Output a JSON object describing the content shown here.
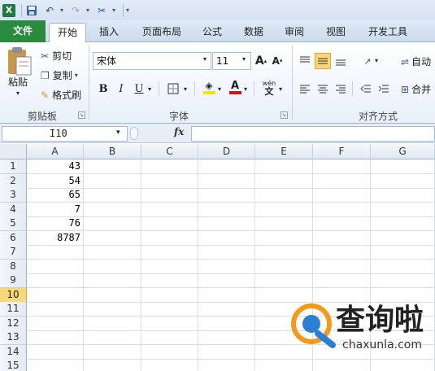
{
  "qat": {
    "logo": "X",
    "undo": "↶",
    "redo": "↷",
    "tool": "✂",
    "dd": "▾"
  },
  "tabs": [
    "开始",
    "插入",
    "页面布局",
    "公式",
    "数据",
    "审阅",
    "视图",
    "开发工具"
  ],
  "file_tab": "文件",
  "clipboard": {
    "paste": "粘贴",
    "cut": "剪切",
    "copy": "复制",
    "format_painter": "格式刷",
    "label": "剪贴板"
  },
  "font": {
    "name": "宋体",
    "size": "11",
    "bold": "B",
    "italic": "I",
    "underline": "U",
    "label": "字体",
    "grow": "A",
    "shrink": "A",
    "wen": "wén",
    "fill_color": "#f5e300",
    "font_color": "#d0141b"
  },
  "align": {
    "wrap": "自动",
    "merge": "合并",
    "label": "对齐方式"
  },
  "formula": {
    "cell_ref": "I10",
    "fx": "fx",
    "value": ""
  },
  "columns": [
    "A",
    "B",
    "C",
    "D",
    "E",
    "F",
    "G"
  ],
  "rows": [
    "1",
    "2",
    "3",
    "4",
    "5",
    "6",
    "7",
    "8",
    "9",
    "10",
    "11",
    "12",
    "13",
    "14",
    "15"
  ],
  "selected_row": "10",
  "col_a_values": [
    "43",
    "54",
    "65",
    "7",
    "76",
    "8787"
  ],
  "watermark": {
    "text": "查询啦",
    "url": "chaxunla.com",
    "accent": "#2b7fd4",
    "orange": "#f39a18"
  }
}
